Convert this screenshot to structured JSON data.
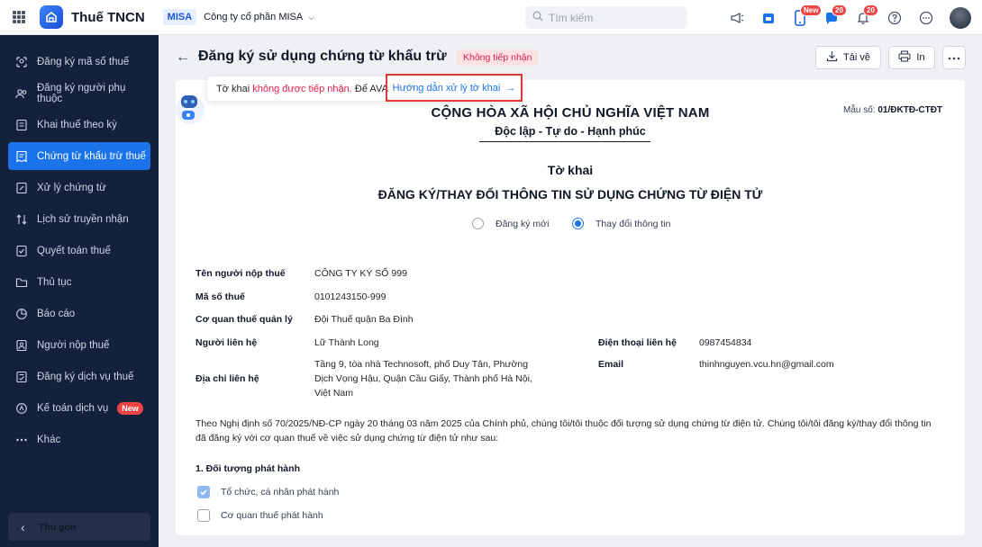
{
  "header": {
    "app_title": "Thuế TNCN",
    "org_badge": "MISA",
    "company": "Công ty cổ phần MISA",
    "search_placeholder": "Tìm kiếm",
    "new_label": "New",
    "chat_count": "20",
    "notification_count": "20"
  },
  "sidebar": {
    "items": [
      {
        "label": "Đăng ký mã số thuế",
        "icon": "user-search-icon"
      },
      {
        "label": "Đăng ký người phụ thuộc",
        "icon": "users-icon"
      },
      {
        "label": "Khai thuế theo kỳ",
        "icon": "document-icon"
      },
      {
        "label": "Chứng từ khấu trừ thuế",
        "icon": "receipt-icon",
        "active": true
      },
      {
        "label": "Xử lý chứng từ",
        "icon": "edit-doc-icon"
      },
      {
        "label": "Lịch sử truyền nhận",
        "icon": "transfer-icon"
      },
      {
        "label": "Quyết toán thuế",
        "icon": "settlement-icon"
      },
      {
        "label": "Thủ tục",
        "icon": "folder-icon"
      },
      {
        "label": "Báo cáo",
        "icon": "pie-chart-icon"
      },
      {
        "label": "Người nộp thuế",
        "icon": "taxpayer-icon"
      },
      {
        "label": "Đăng ký dịch vụ thuế",
        "icon": "service-icon"
      },
      {
        "label": "Kế toán dịch vụ",
        "icon": "accounting-icon",
        "badge": "New"
      },
      {
        "label": "Khác",
        "icon": "more-icon"
      }
    ],
    "collapse_label": "Thu gọn"
  },
  "page": {
    "title": "Đăng ký sử dụng chứng từ khấu trừ",
    "status": "Không tiếp nhận",
    "download_label": "Tải về",
    "print_label": "In"
  },
  "notice": {
    "prefix": "Tờ khai",
    "highlight": "không được tiếp nhận.",
    "suffix": "Để AVA",
    "link": "Hướng dẫn xử lý tờ khai"
  },
  "document": {
    "form_code_label": "Mẫu số:",
    "form_code": "01/ĐKTĐ-CTĐT",
    "nation": "CỘNG HÒA XÃ HỘI CHỦ NGHĨA VIỆT NAM",
    "motto": "Độc lập - Tự do - Hạnh phúc",
    "title_1": "Tờ khai",
    "title_2": "ĐĂNG KÝ/THAY ĐỔI THÔNG TIN SỬ DỤNG CHỨNG TỪ ĐIỆN TỬ",
    "radio_new": "Đăng ký mới",
    "radio_change": "Thay đổi thông tin",
    "selected_radio": "Thay đổi thông tin",
    "fields": {
      "taxpayer_name_label": "Tên người nộp thuế",
      "taxpayer_name": "CÔNG TY KÝ SỐ 999",
      "tax_code_label": "Mã số thuế",
      "tax_code": "0101243150-999",
      "tax_office_label": "Cơ quan thuế quản lý",
      "tax_office": "Đội Thuế quận Ba Đình",
      "contact_label": "Người liên hệ",
      "contact": "Lữ Thành Long",
      "phone_label": "Điện thoại liên hệ",
      "phone": "0987454834",
      "address_label": "Địa chỉ liên hệ",
      "address_line_1": "Tầng 9, tòa nhà Technosoft, phố Duy Tân, Phường",
      "address_line_2": "Dịch Vọng Hậu, Quận Cầu Giấy, Thành phố Hà Nội,",
      "address_line_3": "Việt Nam",
      "email_label": "Email",
      "email": "thinhnguyen.vcu.hn@gmail.com"
    },
    "paragraph": "Theo Nghị định số 70/2025/NĐ-CP ngày 20 tháng 03 năm 2025 của Chính phủ, chúng tôi/tôi thuộc đối tượng sử dụng chứng từ điện tử. Chúng tôi/tôi đăng ký/thay đổi thông tin đã đăng ký với cơ quan thuế về việc sử dụng chứng từ điện tử như sau:",
    "section_1": "1. Đối tượng phát hành",
    "option_org": "Tổ chức, cá nhân phát hành",
    "option_org_checked": true,
    "option_tax_office": "Cơ quan thuế phát hành",
    "option_tax_office_checked": false
  }
}
